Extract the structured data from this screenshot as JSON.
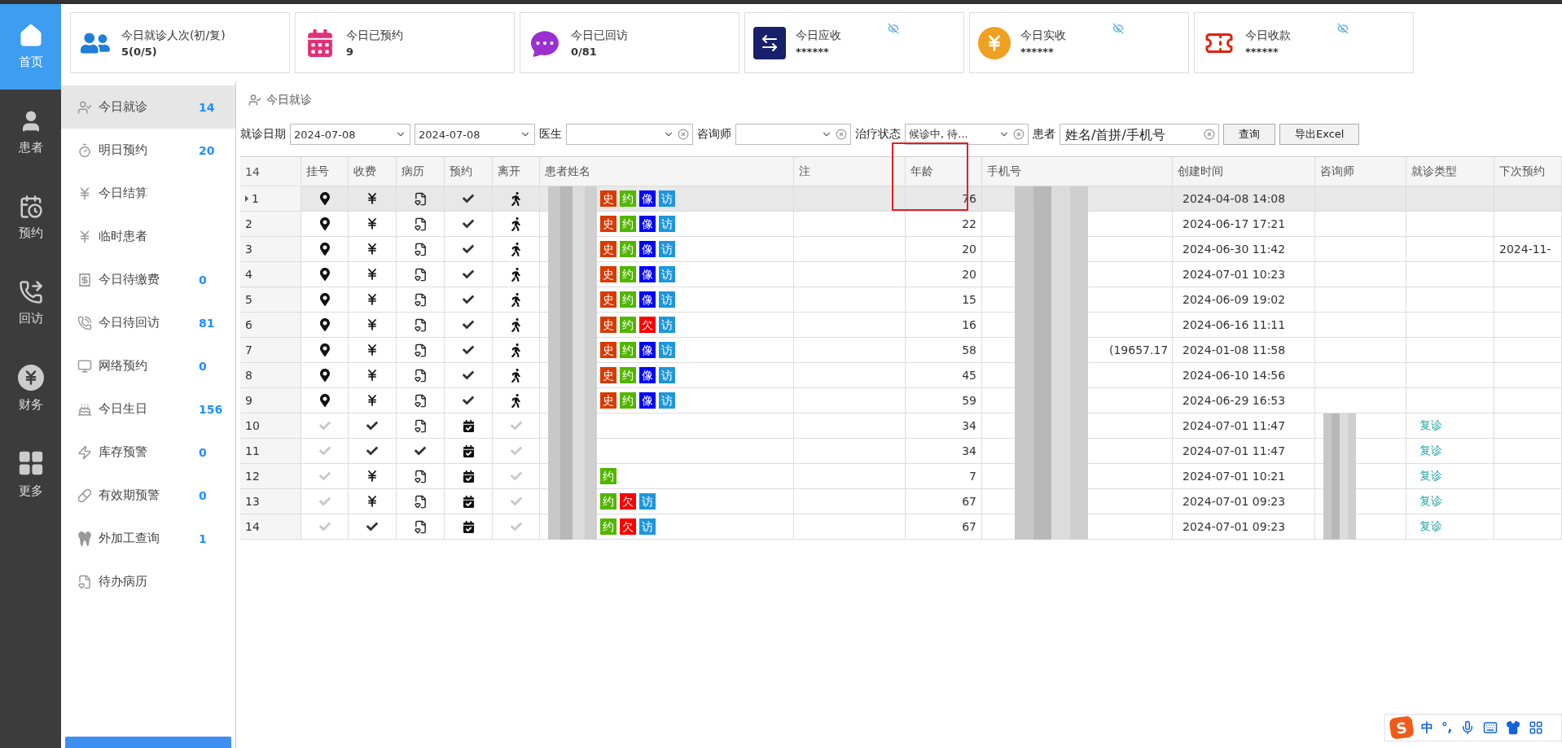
{
  "nav": [
    {
      "label": "首页",
      "selected": true
    },
    {
      "label": "患者",
      "selected": false
    },
    {
      "label": "预约",
      "selected": false
    },
    {
      "label": "回访",
      "selected": false
    },
    {
      "label": "财务",
      "selected": false
    },
    {
      "label": "更多",
      "selected": false
    }
  ],
  "stats": [
    {
      "title": "今日就诊人次(初/复)",
      "value": "5(0/5)",
      "masked": false
    },
    {
      "title": "今日已预约",
      "value": "9",
      "masked": false
    },
    {
      "title": "今日已回访",
      "value": "0/81",
      "masked": false
    },
    {
      "title": "今日应收",
      "value": "******",
      "masked": true
    },
    {
      "title": "今日实收",
      "value": "******",
      "masked": true
    },
    {
      "title": "今日收款",
      "value": "******",
      "masked": true
    }
  ],
  "sidebar": {
    "items": [
      {
        "label": "今日就诊",
        "count": "14",
        "selected": true
      },
      {
        "label": "明日预约",
        "count": "20",
        "selected": false
      },
      {
        "label": "今日结算",
        "selected": false
      },
      {
        "label": "临时患者",
        "selected": false
      },
      {
        "label": "今日待缴费",
        "count": "0",
        "selected": false
      },
      {
        "label": "今日待回访",
        "count": "81",
        "selected": false
      },
      {
        "label": "网络预约",
        "count": "0",
        "selected": false
      },
      {
        "label": "今日生日",
        "count": "156",
        "selected": false
      },
      {
        "label": "库存预警",
        "count": "0",
        "selected": false
      },
      {
        "label": "有效期预警",
        "count": "0",
        "selected": false
      },
      {
        "label": "外加工查询",
        "count": "1",
        "selected": false
      },
      {
        "label": "待办病历",
        "selected": false
      }
    ]
  },
  "panel": {
    "title": "今日就诊"
  },
  "filters": {
    "date_label": "就诊日期",
    "date_from": "2024-07-08",
    "date_to": "2024-07-08",
    "doctor_label": "医生",
    "consultant_label": "咨询师",
    "status_label": "治疗状态",
    "status_value": "候诊中, 待...",
    "patient_label": "患者",
    "patient_placeholder": "姓名/首拼/手机号",
    "search_button": "查询",
    "export_button": "导出Excel"
  },
  "table": {
    "columns": [
      {
        "label": "14"
      },
      {
        "label": "挂号"
      },
      {
        "label": "收费"
      },
      {
        "label": "病历"
      },
      {
        "label": "预约"
      },
      {
        "label": "离开"
      },
      {
        "label": "患者姓名"
      },
      {
        "label": "注"
      },
      {
        "label": "年龄",
        "outlined": true
      },
      {
        "label": "手机号"
      },
      {
        "label": "创建时间"
      },
      {
        "label": "咨询师"
      },
      {
        "label": "就诊类型"
      },
      {
        "label": "下次预约"
      }
    ],
    "rows": [
      {
        "number": "1",
        "selected": true,
        "status_cells": [
          {
            "kind": "pin"
          },
          {
            "kind": "yen"
          },
          {
            "kind": "record"
          },
          {
            "kind": "check"
          },
          {
            "kind": "walk"
          }
        ],
        "tags": [
          {
            "label": "史",
            "color": "#d83b01"
          },
          {
            "label": "约",
            "color": "#52b500"
          },
          {
            "label": "像",
            "color": "#0000ff"
          },
          {
            "label": "访",
            "color": "#1e96dc"
          }
        ],
        "age": "76",
        "created": "2024-04-08 14:08",
        "consultant_hidden": false
      },
      {
        "number": "2",
        "selected": false,
        "status_cells": [
          {
            "kind": "pin"
          },
          {
            "kind": "yen"
          },
          {
            "kind": "record"
          },
          {
            "kind": "check"
          },
          {
            "kind": "walk"
          }
        ],
        "tags": [
          {
            "label": "史",
            "color": "#d83b01"
          },
          {
            "label": "约",
            "color": "#52b500"
          },
          {
            "label": "像",
            "color": "#0000ff"
          },
          {
            "label": "访",
            "color": "#1e96dc"
          }
        ],
        "age": "22",
        "created": "2024-06-17 17:21",
        "consultant_hidden": false
      },
      {
        "number": "3",
        "selected": false,
        "status_cells": [
          {
            "kind": "pin"
          },
          {
            "kind": "yen"
          },
          {
            "kind": "record"
          },
          {
            "kind": "check"
          },
          {
            "kind": "walk"
          }
        ],
        "tags": [
          {
            "label": "史",
            "color": "#d83b01"
          },
          {
            "label": "约",
            "color": "#52b500"
          },
          {
            "label": "像",
            "color": "#0000ff"
          },
          {
            "label": "访",
            "color": "#1e96dc"
          }
        ],
        "age": "20",
        "created": "2024-06-30 11:42",
        "consultant_hidden": false,
        "next_visit": "2024-11-"
      },
      {
        "number": "4",
        "selected": false,
        "status_cells": [
          {
            "kind": "pin"
          },
          {
            "kind": "yen"
          },
          {
            "kind": "record"
          },
          {
            "kind": "check"
          },
          {
            "kind": "walk"
          }
        ],
        "tags": [
          {
            "label": "史",
            "color": "#d83b01"
          },
          {
            "label": "约",
            "color": "#52b500"
          },
          {
            "label": "像",
            "color": "#0000ff"
          },
          {
            "label": "访",
            "color": "#1e96dc"
          }
        ],
        "age": "20",
        "created": "2024-07-01 10:23",
        "consultant_hidden": false
      },
      {
        "number": "5",
        "selected": false,
        "status_cells": [
          {
            "kind": "pin"
          },
          {
            "kind": "yen"
          },
          {
            "kind": "record"
          },
          {
            "kind": "check"
          },
          {
            "kind": "walk"
          }
        ],
        "tags": [
          {
            "label": "史",
            "color": "#d83b01"
          },
          {
            "label": "约",
            "color": "#52b500"
          },
          {
            "label": "像",
            "color": "#0000ff"
          },
          {
            "label": "访",
            "color": "#1e96dc"
          }
        ],
        "age": "15",
        "created": "2024-06-09 19:02",
        "consultant_hidden": false
      },
      {
        "number": "6",
        "selected": false,
        "status_cells": [
          {
            "kind": "pin"
          },
          {
            "kind": "yen"
          },
          {
            "kind": "record"
          },
          {
            "kind": "check"
          },
          {
            "kind": "walk"
          }
        ],
        "tags": [
          {
            "label": "史",
            "color": "#d83b01"
          },
          {
            "label": "约",
            "color": "#52b500"
          },
          {
            "label": "欠",
            "color": "#ff0000"
          },
          {
            "label": "访",
            "color": "#1e96dc"
          }
        ],
        "age": "16",
        "created": "2024-06-16 11:11",
        "consultant_hidden": false
      },
      {
        "number": "7",
        "selected": false,
        "status_cells": [
          {
            "kind": "pin"
          },
          {
            "kind": "yen"
          },
          {
            "kind": "record"
          },
          {
            "kind": "check"
          },
          {
            "kind": "walk"
          }
        ],
        "tags": [
          {
            "label": "史",
            "color": "#d83b01"
          },
          {
            "label": "约",
            "color": "#52b500"
          },
          {
            "label": "像",
            "color": "#0000ff"
          },
          {
            "label": "访",
            "color": "#1e96dc"
          }
        ],
        "age": "58",
        "phone": "(19657.17",
        "created": "2024-01-08 11:58",
        "consultant_hidden": false
      },
      {
        "number": "8",
        "selected": false,
        "status_cells": [
          {
            "kind": "pin"
          },
          {
            "kind": "yen"
          },
          {
            "kind": "record"
          },
          {
            "kind": "check"
          },
          {
            "kind": "walk"
          }
        ],
        "tags": [
          {
            "label": "史",
            "color": "#d83b01"
          },
          {
            "label": "约",
            "color": "#52b500"
          },
          {
            "label": "像",
            "color": "#0000ff"
          },
          {
            "label": "访",
            "color": "#1e96dc"
          }
        ],
        "age": "45",
        "created": "2024-06-10 14:56",
        "consultant_hidden": false
      },
      {
        "number": "9",
        "selected": false,
        "status_cells": [
          {
            "kind": "pin"
          },
          {
            "kind": "yen"
          },
          {
            "kind": "record"
          },
          {
            "kind": "check"
          },
          {
            "kind": "walk"
          }
        ],
        "tags": [
          {
            "label": "史",
            "color": "#d83b01"
          },
          {
            "label": "约",
            "color": "#52b500"
          },
          {
            "label": "像",
            "color": "#0000ff"
          },
          {
            "label": "访",
            "color": "#1e96dc"
          }
        ],
        "age": "59",
        "created": "2024-06-29 16:53",
        "consultant_hidden": false
      },
      {
        "number": "10",
        "selected": false,
        "status_cells": [
          {
            "kind": "check-light"
          },
          {
            "kind": "check"
          },
          {
            "kind": "record"
          },
          {
            "kind": "calendar"
          },
          {
            "kind": "check-light"
          }
        ],
        "age": "34",
        "created": "2024-07-01 11:47",
        "consultant_hidden": true,
        "visit_type": "复诊"
      },
      {
        "number": "11",
        "selected": false,
        "status_cells": [
          {
            "kind": "check-light"
          },
          {
            "kind": "check"
          },
          {
            "kind": "check"
          },
          {
            "kind": "calendar"
          },
          {
            "kind": "check-light"
          }
        ],
        "age": "34",
        "created": "2024-07-01 11:47",
        "consultant_hidden": true,
        "visit_type": "复诊"
      },
      {
        "number": "12",
        "selected": false,
        "status_cells": [
          {
            "kind": "check-light"
          },
          {
            "kind": "yen"
          },
          {
            "kind": "record"
          },
          {
            "kind": "calendar"
          },
          {
            "kind": "check-light"
          }
        ],
        "tags": [
          {
            "label": "约",
            "color": "#52b500"
          }
        ],
        "age": "7",
        "created": "2024-07-01 10:21",
        "consultant_hidden": true,
        "visit_type": "复诊"
      },
      {
        "number": "13",
        "selected": false,
        "status_cells": [
          {
            "kind": "check-light"
          },
          {
            "kind": "yen"
          },
          {
            "kind": "record"
          },
          {
            "kind": "calendar"
          },
          {
            "kind": "check-light"
          }
        ],
        "tags": [
          {
            "label": "约",
            "color": "#52b500"
          },
          {
            "label": "欠",
            "color": "#ff0000"
          },
          {
            "label": "访",
            "color": "#1e96dc"
          }
        ],
        "age": "67",
        "created": "2024-07-01 09:23",
        "consultant_hidden": true,
        "visit_type": "复诊"
      },
      {
        "number": "14",
        "selected": false,
        "status_cells": [
          {
            "kind": "check-light"
          },
          {
            "kind": "check"
          },
          {
            "kind": "record"
          },
          {
            "kind": "calendar"
          },
          {
            "kind": "check-light"
          }
        ],
        "tags": [
          {
            "label": "约",
            "color": "#52b500"
          },
          {
            "label": "欠",
            "color": "#ff0000"
          },
          {
            "label": "访",
            "color": "#1e96dc"
          }
        ],
        "age": "67",
        "created": "2024-07-01 09:23",
        "consultant_hidden": true,
        "visit_type": "复诊"
      }
    ]
  },
  "ime_bar": {
    "logo": "S",
    "mode": "中",
    "punct": "°,"
  }
}
